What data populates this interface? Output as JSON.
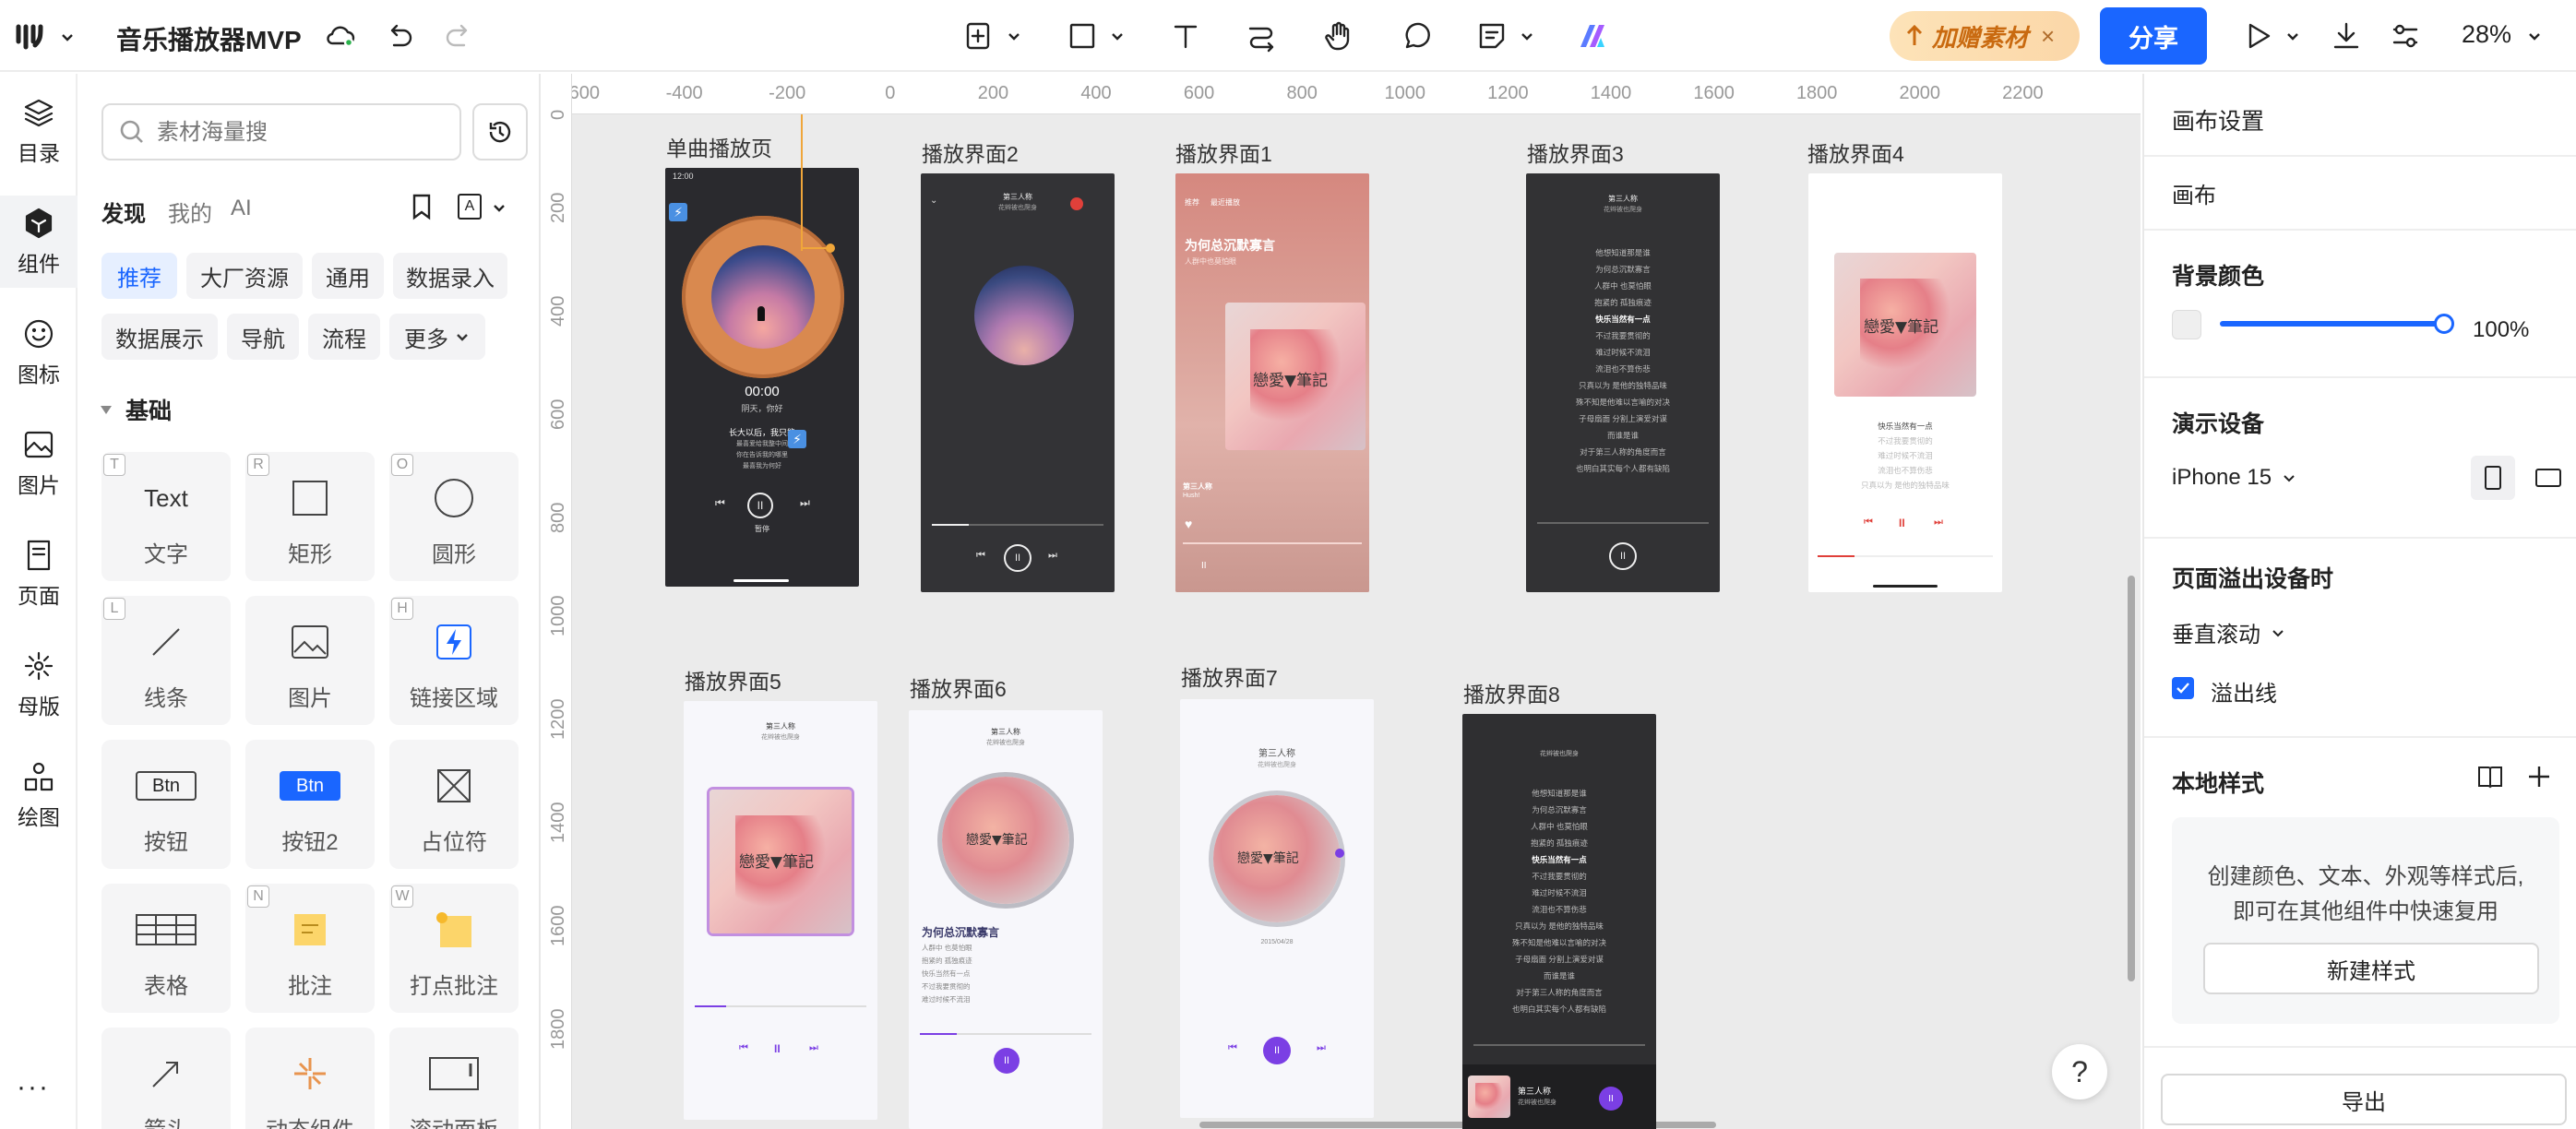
{
  "app": {
    "title": "音乐播放器MVP"
  },
  "topbar": {
    "promo_label": "加赠素材",
    "share_label": "分享",
    "zoom": "28%"
  },
  "rail": [
    {
      "label": "目录",
      "icon": "layers-icon"
    },
    {
      "label": "组件",
      "icon": "component-icon"
    },
    {
      "label": "图标",
      "icon": "smiley-icon"
    },
    {
      "label": "图片",
      "icon": "image-icon"
    },
    {
      "label": "页面",
      "icon": "page-icon"
    },
    {
      "label": "母版",
      "icon": "master-icon"
    },
    {
      "label": "绘图",
      "icon": "draw-icon"
    }
  ],
  "panel": {
    "search_placeholder": "素材海量搜",
    "tabs": [
      "发现",
      "我的",
      "AI"
    ],
    "chips_row1": [
      "推荐",
      "大厂资源",
      "通用",
      "数据录入"
    ],
    "chips_row2": [
      "数据展示",
      "导航",
      "流程",
      "更多"
    ],
    "section_title": "基础",
    "tiles": [
      {
        "label": "文字",
        "key": "T",
        "preview": "Text"
      },
      {
        "label": "矩形",
        "key": "R"
      },
      {
        "label": "圆形",
        "key": "O"
      },
      {
        "label": "线条",
        "key": "L"
      },
      {
        "label": "图片",
        "key": ""
      },
      {
        "label": "链接区域",
        "key": "H"
      },
      {
        "label": "按钮",
        "key": "",
        "preview": "Btn"
      },
      {
        "label": "按钮2",
        "key": "",
        "preview": "Btn"
      },
      {
        "label": "占位符",
        "key": ""
      },
      {
        "label": "表格",
        "key": ""
      },
      {
        "label": "批注",
        "key": "N"
      },
      {
        "label": "打点批注",
        "key": "W"
      },
      {
        "label": "箭头",
        "key": ""
      },
      {
        "label": "动态组件",
        "key": ""
      },
      {
        "label": "滚动面板",
        "key": ""
      }
    ]
  },
  "ruler": {
    "h": [
      "-600",
      "-400",
      "-200",
      "0",
      "200",
      "400",
      "600",
      "800",
      "1000",
      "1200",
      "1400",
      "1600",
      "1800",
      "2000",
      "2200"
    ],
    "v": [
      "0",
      "200",
      "400",
      "600",
      "800",
      "1000",
      "1200",
      "1400",
      "1600",
      "1800"
    ]
  },
  "frames": [
    {
      "title": "单曲播放页",
      "time": "00:00",
      "sub": "阴天，你好",
      "l1": "长大以后，我只能",
      "l2": "最喜爱给我整中间",
      "l3": "你在告诉我的哪里",
      "l4": "最喜我为何好",
      "state": "暂停"
    },
    {
      "title": "播放界面2",
      "song": "第三人称",
      "artist": "花辫被也爬身"
    },
    {
      "title": "播放界面1",
      "tab1": "推荐",
      "tab2": "最近播放",
      "headline": "为何总沉默寡言",
      "sub": "人群中也莫怕眼",
      "song": "第三人称",
      "artist": "Hush!"
    },
    {
      "title": "播放界面3",
      "song": "第三人称",
      "artist": "花辫被也爬身",
      "lyrics": [
        "他想知道那是谁",
        "为何总沉默寡言",
        "人群中 也莫怕眼",
        "抱紧的 孤独痕迹",
        "快乐当然有一点",
        "不过我要贯彻的",
        "难过时候不流泪",
        "流泪也不算伤悲",
        "只真以为 是他的独特品味",
        "殊不知是他难以言喻的对决",
        "子母扇面 分割上演爱对谋",
        "而谁是谁",
        "对于第三人称的角度而言",
        "也明白其实每个人都有缺陷"
      ]
    },
    {
      "title": "播放界面4",
      "lyrics": [
        "快乐当然有一点",
        "不过我要贯彻的",
        "难过时候不流泪",
        "流泪也不算伤悲",
        "只真以为 是他的独特品味"
      ]
    },
    {
      "title": "播放界面5",
      "song": "第三人称",
      "artist": "花辫被也爬身"
    },
    {
      "title": "播放界面6",
      "song": "第三人称",
      "artist": "花辫被也爬身",
      "headline": "为何总沉默寡言",
      "lyrics": [
        "人群中 也莫怕眼",
        "抱紧的 孤独痕迹",
        "快乐当然有一点",
        "不过我要贯彻的",
        "难过时候不流泪"
      ]
    },
    {
      "title": "播放界面7",
      "song": "第三人称",
      "artist": "花辫被也爬身",
      "date": "2015/04/28"
    },
    {
      "title": "播放界面8",
      "artist": "花辫被也爬身",
      "song": "第三人称",
      "lyrics": [
        "他想知道那是谁",
        "为何总沉默寡言",
        "人群中 也莫怕眼",
        "抱紧的 孤独痕迹",
        "快乐当然有一点",
        "不过我要贯彻的",
        "难过时候不流泪",
        "流泪也不算伤悲",
        "只真以为 是他的独特品味",
        "殊不知是他难以言喻的对决",
        "子母扇面 分割上演爱对谋",
        "而谁是谁",
        "对于第三人称的角度而言",
        "也明白其实每个人都有缺陷"
      ]
    }
  ],
  "art_text": "戀愛▼筆記",
  "props": {
    "section1": "画布设置",
    "canvas_label": "画布",
    "bg_color_label": "背景颜色",
    "opacity": "100%",
    "device_label": "演示设备",
    "device_value": "iPhone 15",
    "overflow_label": "页面溢出设备时",
    "overflow_value": "垂直滚动",
    "overflow_line_label": "溢出线",
    "local_style_label": "本地样式",
    "local_style_desc1": "创建颜色、文本、外观等样式后,",
    "local_style_desc2": "即可在其他组件中快速复用",
    "new_style_button": "新建样式",
    "export_button": "导出",
    "help": "?"
  },
  "colors": {
    "accent": "#1a66ff",
    "purple": "#7b3fe4",
    "red": "#e0403a",
    "orange": "#e8944e"
  }
}
